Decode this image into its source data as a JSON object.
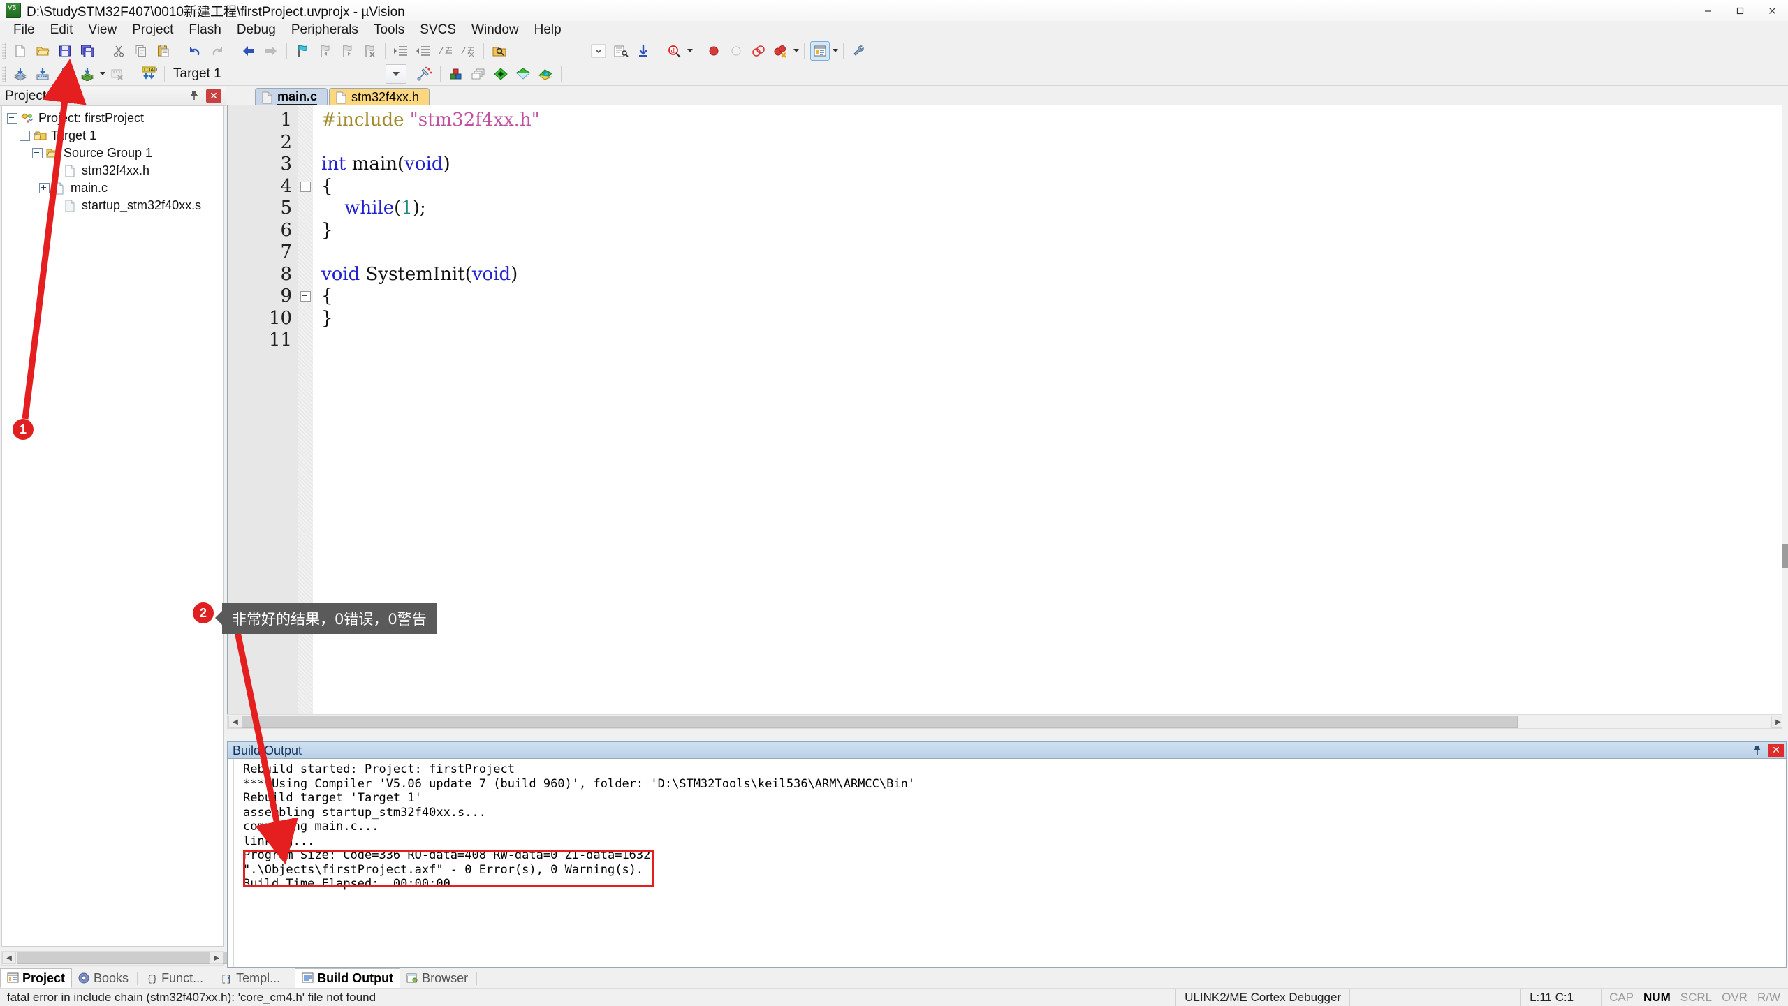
{
  "window": {
    "title": "D:\\StudySTM32F407\\0010新建工程\\firstProject.uvprojx - µVision",
    "app_icon": "keil-uvision-icon",
    "minimize": "—",
    "maximize": "▢",
    "close": "✕"
  },
  "menu": {
    "items": [
      "File",
      "Edit",
      "View",
      "Project",
      "Flash",
      "Debug",
      "Peripherals",
      "Tools",
      "SVCS",
      "Window",
      "Help"
    ]
  },
  "toolbar_main": {
    "buttons": [
      {
        "name": "new-file-icon",
        "tip": "New"
      },
      {
        "name": "open-file-icon",
        "tip": "Open"
      },
      {
        "name": "save-icon",
        "tip": "Save"
      },
      {
        "name": "save-all-icon",
        "tip": "Save All"
      },
      {
        "name": "cut-icon",
        "tip": "Cut"
      },
      {
        "name": "copy-icon",
        "tip": "Copy"
      },
      {
        "name": "paste-icon",
        "tip": "Paste"
      },
      {
        "name": "undo-icon",
        "tip": "Undo"
      },
      {
        "name": "redo-icon",
        "tip": "Redo"
      },
      {
        "name": "navigate-back-icon",
        "tip": "Back"
      },
      {
        "name": "navigate-forward-icon",
        "tip": "Forward"
      },
      {
        "name": "bookmark-toggle-icon",
        "tip": "Insert/Remove Bookmark"
      },
      {
        "name": "bookmark-prev-icon",
        "tip": "Previous Bookmark"
      },
      {
        "name": "bookmark-next-icon",
        "tip": "Next Bookmark"
      },
      {
        "name": "bookmark-clear-icon",
        "tip": "Clear All Bookmarks"
      },
      {
        "name": "indent-icon",
        "tip": "Indent"
      },
      {
        "name": "outdent-icon",
        "tip": "Outdent"
      },
      {
        "name": "comment-icon",
        "tip": "Comment"
      },
      {
        "name": "uncomment-icon",
        "tip": "Uncomment"
      },
      {
        "name": "find-in-files-icon",
        "tip": "Find in Files"
      },
      {
        "name": "dropdown-blank-icon",
        "tip": "Combo"
      },
      {
        "name": "configure-wizard-icon",
        "tip": "Configuration Wizard"
      },
      {
        "name": "goto-definition-icon",
        "tip": "Go To Definition"
      },
      {
        "name": "find-icon",
        "tip": "Find"
      },
      {
        "name": "breakpoint-icon",
        "tip": "Insert/Remove Breakpoint"
      },
      {
        "name": "breakpoint-disable-icon",
        "tip": "Enable/Disable Breakpoint"
      },
      {
        "name": "breakpoint-disable-all-icon",
        "tip": "Disable All Breakpoints"
      },
      {
        "name": "breakpoint-kill-all-icon",
        "tip": "Kill All Breakpoints"
      },
      {
        "name": "project-window-icon",
        "tip": "Project Window"
      },
      {
        "name": "utilities-icon",
        "tip": "Utilities"
      }
    ]
  },
  "toolbar_build": {
    "buttons": [
      {
        "name": "translate-icon",
        "tip": "Translate"
      },
      {
        "name": "build-icon",
        "tip": "Build"
      },
      {
        "name": "rebuild-icon",
        "tip": "Rebuild"
      },
      {
        "name": "batch-build-icon",
        "tip": "Batch Build"
      },
      {
        "name": "stop-build-icon",
        "tip": "Stop Build"
      },
      {
        "name": "download-icon",
        "tip": "Download"
      },
      {
        "name": "start-debug-icon",
        "tip": "Start/Stop Debug Session"
      },
      {
        "name": "target-options-icon",
        "tip": "Options for Target"
      },
      {
        "name": "manage-windows-icon",
        "tip": "Manage Project Items"
      },
      {
        "name": "pack-installer-icon",
        "tip": "Pack Installer"
      },
      {
        "name": "manage-run-time-icon",
        "tip": "Manage Run-Time Environment"
      },
      {
        "name": "select-software-packs-icon",
        "tip": "Select Software Packs"
      }
    ],
    "target_combo_value": "Target 1"
  },
  "project_panel": {
    "title": "Project",
    "pin_icon": "pin-icon",
    "close_icon": "close-icon",
    "tree": [
      {
        "label": "Project: firstProject",
        "depth": 0,
        "expander": "minus",
        "icon": "project-icon"
      },
      {
        "label": "Target 1",
        "depth": 1,
        "expander": "minus",
        "icon": "target-folder-icon"
      },
      {
        "label": "Source Group 1",
        "depth": 2,
        "expander": "minus",
        "icon": "folder-icon"
      },
      {
        "label": "stm32f4xx.h",
        "depth": 3,
        "expander": "none",
        "icon": "header-file-icon"
      },
      {
        "label": "main.c",
        "depth": 3,
        "expander": "plus",
        "icon": "c-file-icon"
      },
      {
        "label": "startup_stm32f40xx.s",
        "depth": 3,
        "expander": "none",
        "icon": "asm-file-icon"
      }
    ]
  },
  "editor": {
    "tabs": [
      {
        "label": "main.c",
        "active": true,
        "icon": "c-file-icon"
      },
      {
        "label": "stm32f4xx.h",
        "active": false,
        "icon": "header-file-icon"
      }
    ],
    "lines": [
      {
        "no": "1",
        "fold": "none",
        "tokens": [
          {
            "t": "#include ",
            "c": "k-pre"
          },
          {
            "t": "\"stm32f4xx.h\"",
            "c": "k-str"
          }
        ]
      },
      {
        "no": "2",
        "fold": "none",
        "tokens": []
      },
      {
        "no": "3",
        "fold": "none",
        "tokens": [
          {
            "t": "int",
            "c": "k-kw"
          },
          {
            "t": " main",
            "c": "k-fn"
          },
          {
            "t": "(",
            "c": "k-pl"
          },
          {
            "t": "void",
            "c": "k-kw"
          },
          {
            "t": ")",
            "c": "k-pl"
          }
        ]
      },
      {
        "no": "4",
        "fold": "box",
        "tokens": [
          {
            "t": "{",
            "c": "k-pl"
          }
        ]
      },
      {
        "no": "5",
        "fold": "line",
        "tokens": [
          {
            "t": "    ",
            "c": "k-pl"
          },
          {
            "t": "while",
            "c": "k-kw"
          },
          {
            "t": "(",
            "c": "k-pl"
          },
          {
            "t": "1",
            "c": "k-num"
          },
          {
            "t": ");",
            "c": "k-pl"
          }
        ]
      },
      {
        "no": "6",
        "fold": "line",
        "tokens": [
          {
            "t": "}",
            "c": "k-pl"
          }
        ]
      },
      {
        "no": "7",
        "fold": "end",
        "tokens": []
      },
      {
        "no": "8",
        "fold": "none",
        "tokens": [
          {
            "t": "void",
            "c": "k-kw"
          },
          {
            "t": " SystemInit",
            "c": "k-fn"
          },
          {
            "t": "(",
            "c": "k-pl"
          },
          {
            "t": "void",
            "c": "k-kw"
          },
          {
            "t": ")",
            "c": "k-pl"
          }
        ]
      },
      {
        "no": "9",
        "fold": "box",
        "tokens": [
          {
            "t": "{",
            "c": "k-pl"
          }
        ]
      },
      {
        "no": "10",
        "fold": "line",
        "tokens": [
          {
            "t": "}",
            "c": "k-pl"
          }
        ]
      },
      {
        "no": "11",
        "fold": "none",
        "tokens": []
      }
    ]
  },
  "build_output": {
    "title": "Build Output",
    "pin_icon": "pin-icon",
    "close_icon": "close-icon",
    "lines": [
      "Rebuild started: Project: firstProject",
      "*** Using Compiler 'V5.06 update 7 (build 960)', folder: 'D:\\STM32Tools\\keil536\\ARM\\ARMCC\\Bin'",
      "Rebuild target 'Target 1'",
      "assembling startup_stm32f40xx.s...",
      "compiling main.c...",
      "linking...",
      "Program Size: Code=336 RO-data=408 RW-data=0 ZI-data=1632  ",
      "\".\\Objects\\firstProject.axf\" - 0 Error(s), 0 Warning(s).",
      "Build Time Elapsed:  00:00:00"
    ],
    "highlight_color": "#e51f1f"
  },
  "bottom_tabs": {
    "left": [
      {
        "label": "Project",
        "selected": true,
        "icon": "project-window-icon"
      },
      {
        "label": "Books",
        "selected": false,
        "icon": "books-icon"
      },
      {
        "label": "Funct...",
        "selected": false,
        "icon": "functions-icon"
      },
      {
        "label": "Templ...",
        "selected": false,
        "icon": "templates-icon"
      }
    ],
    "right": [
      {
        "label": "Build Output",
        "selected": true,
        "icon": "build-output-icon"
      },
      {
        "label": "Browser",
        "selected": false,
        "icon": "browser-icon"
      }
    ]
  },
  "status_bar": {
    "message": "fatal error in include chain (stm32f407xx.h): 'core_cm4.h' file not found",
    "debugger": "ULINK2/ME Cortex Debugger",
    "caret": "L:11 C:1",
    "indicators": [
      {
        "label": "CAP",
        "on": false
      },
      {
        "label": "NUM",
        "on": true
      },
      {
        "label": "SCRL",
        "on": false
      },
      {
        "label": "OVR",
        "on": false
      },
      {
        "label": "R/W",
        "on": false
      }
    ]
  },
  "annotations": {
    "badge1": "1",
    "badge2": "2",
    "tooltip2": "非常好的结果，0错误，0警告",
    "arrow_color": "#e51f1f"
  }
}
